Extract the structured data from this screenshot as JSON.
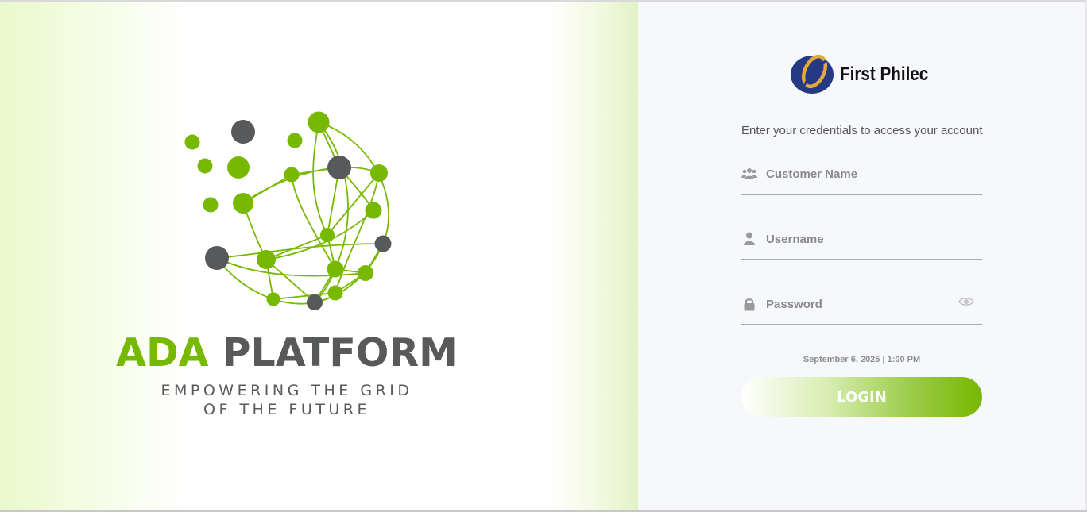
{
  "brand": {
    "title_green": "ADA",
    "title_gray": "PLATFORM",
    "tagline_line1": "EMPOWERING THE GRID",
    "tagline_line2": "OF THE FUTURE"
  },
  "company": {
    "name": "First Philec"
  },
  "login_form": {
    "subtitle": "Enter your credentials to access your account",
    "customer_name_placeholder": "Customer Name",
    "username_placeholder": "Username",
    "password_placeholder": "Password",
    "datetime": "September 6, 2025 | 1:00 PM",
    "login_label": "LOGIN"
  },
  "colors": {
    "brand_green": "#77b800",
    "brand_gray": "#58595b",
    "logo_navy": "#263a83",
    "logo_gold": "#e2a93b",
    "right_panel_bg": "#f6f8fc"
  },
  "icons": {
    "customer": "users-icon",
    "username": "user-icon",
    "password": "lock-icon",
    "toggle_password": "eye-icon"
  }
}
